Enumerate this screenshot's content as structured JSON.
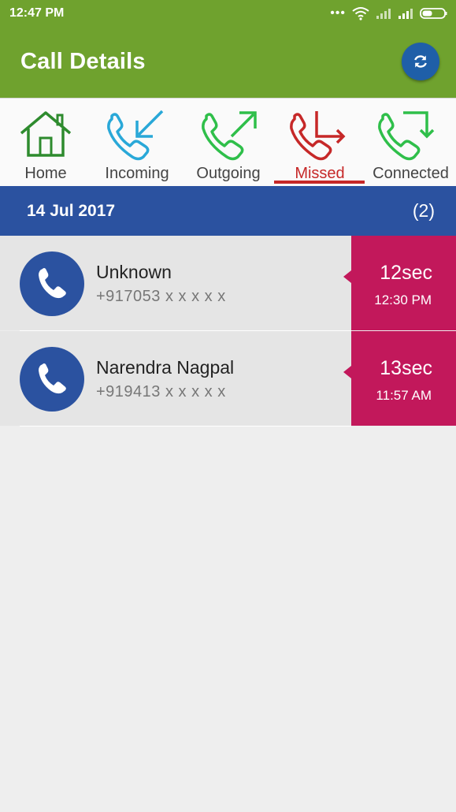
{
  "status_bar": {
    "time": "12:47 PM",
    "icons": [
      "more-icon",
      "wifi-icon",
      "signal-icon",
      "signal-icon",
      "battery-icon"
    ]
  },
  "app_bar": {
    "title": "Call Details",
    "refresh_icon": "refresh-icon"
  },
  "tabs": [
    {
      "label": "Home",
      "icon": "home-icon",
      "color": "#2e8b2e",
      "active": false
    },
    {
      "label": "Incoming",
      "icon": "incoming-call-icon",
      "color": "#29a8d8",
      "active": false
    },
    {
      "label": "Outgoing",
      "icon": "outgoing-call-icon",
      "color": "#2fbf4a",
      "active": false
    },
    {
      "label": "Missed",
      "icon": "missed-call-icon",
      "color": "#c62828",
      "active": true
    },
    {
      "label": "Connected",
      "icon": "connected-call-icon",
      "color": "#2fbf4a",
      "active": false
    }
  ],
  "date_group": {
    "date": "14 Jul 2017",
    "count": "(2)"
  },
  "calls": [
    {
      "name": "Unknown",
      "number": "+917053 x x x x x",
      "duration": "12sec",
      "time": "12:30 PM"
    },
    {
      "name": "Narendra Nagpal",
      "number": "+919413 x x x x x",
      "duration": "13sec",
      "time": "11:57 AM"
    }
  ],
  "colors": {
    "app_bar": "#6fa22e",
    "date_header": "#2b52a0",
    "duration_box": "#c2185b",
    "accent_active": "#c62828"
  }
}
